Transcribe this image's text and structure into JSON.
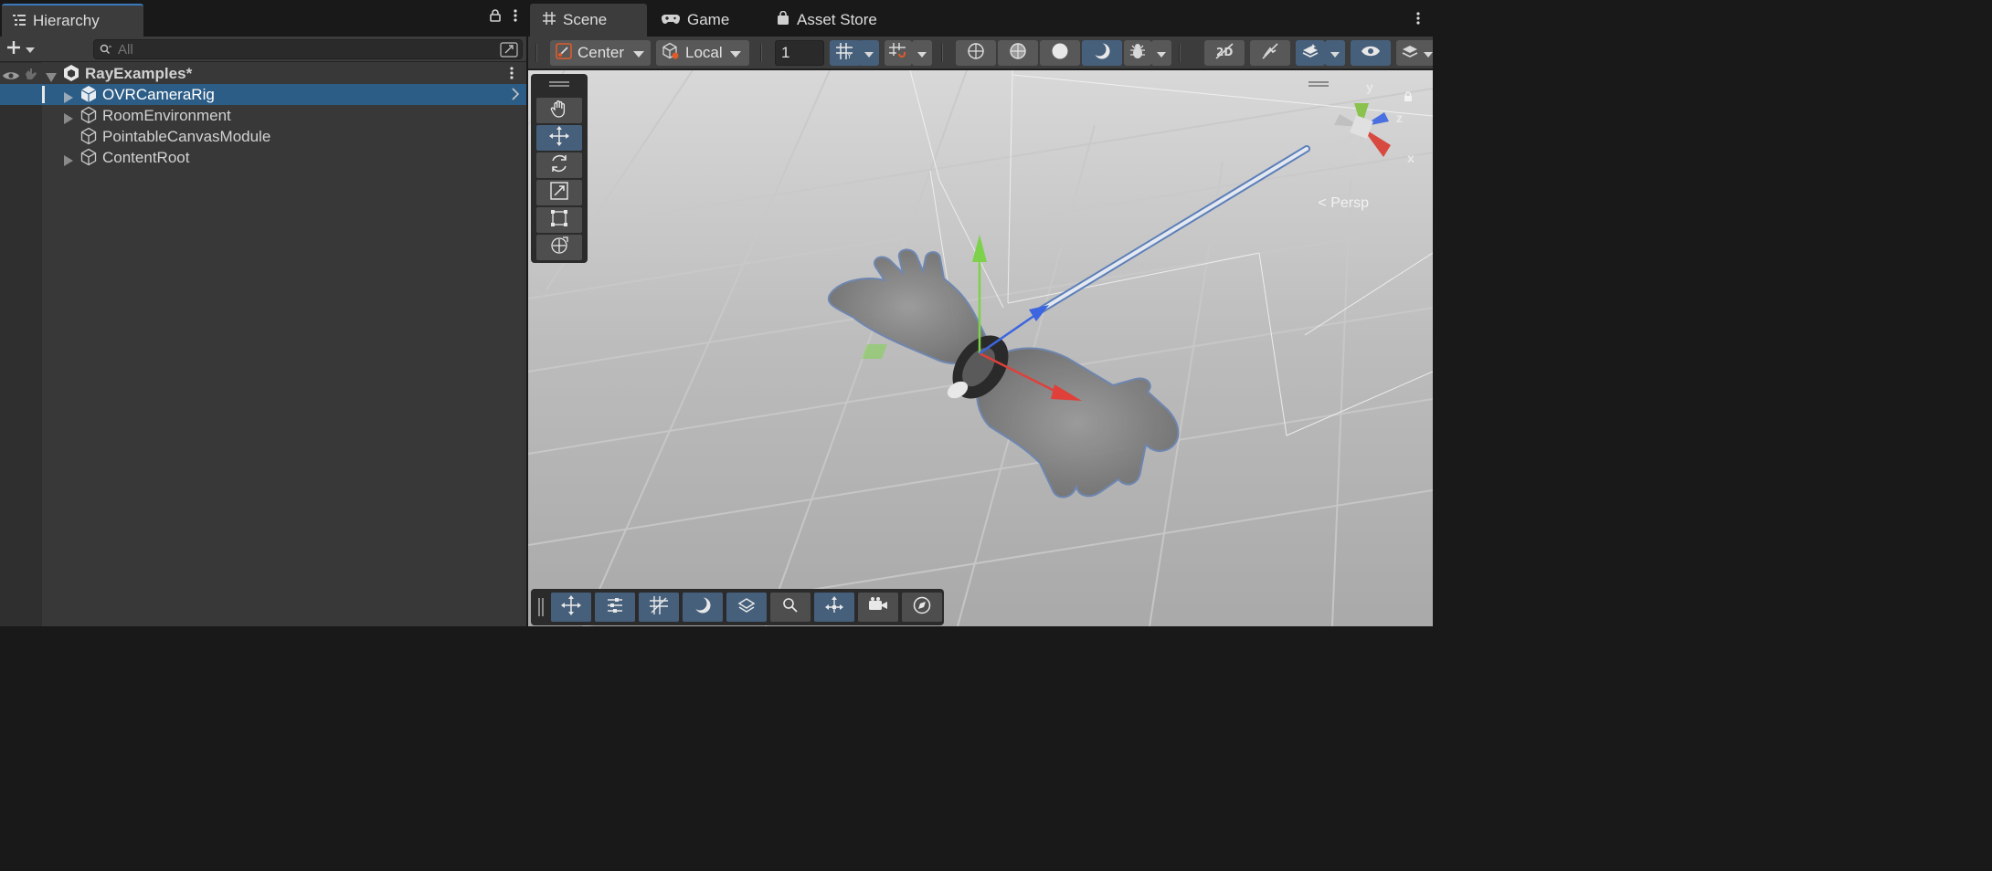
{
  "hierarchy": {
    "tab_title": "Hierarchy",
    "search_placeholder": "All",
    "scene_name": "RayExamples*",
    "items": [
      {
        "label": "OVRCameraRig",
        "expandable": true,
        "selected": true
      },
      {
        "label": "RoomEnvironment",
        "expandable": true,
        "selected": false
      },
      {
        "label": "PointableCanvasModule",
        "expandable": false,
        "selected": false
      },
      {
        "label": "ContentRoot",
        "expandable": true,
        "selected": false
      }
    ]
  },
  "scene_view": {
    "tabs": [
      {
        "label": "Scene",
        "icon": "grid-hash-icon",
        "active": true
      },
      {
        "label": "Game",
        "icon": "gamepad-icon",
        "active": false
      },
      {
        "label": "Asset Store",
        "icon": "shopping-bag-icon",
        "active": false
      }
    ],
    "toolbar": {
      "pivot_mode": "Center",
      "pivot_rotation": "Local",
      "grid_size": "1"
    },
    "projection_label": "Persp",
    "gizmo_axes": {
      "y": "y",
      "z": "z",
      "x": "x"
    }
  },
  "colors": {
    "accent_blue": "#3a79bb",
    "selected_row": "#2c5d87",
    "toggle_on": "#46607c",
    "axis_x": "#e0403a",
    "axis_y": "#7ed14a",
    "axis_z": "#3b66e0"
  }
}
